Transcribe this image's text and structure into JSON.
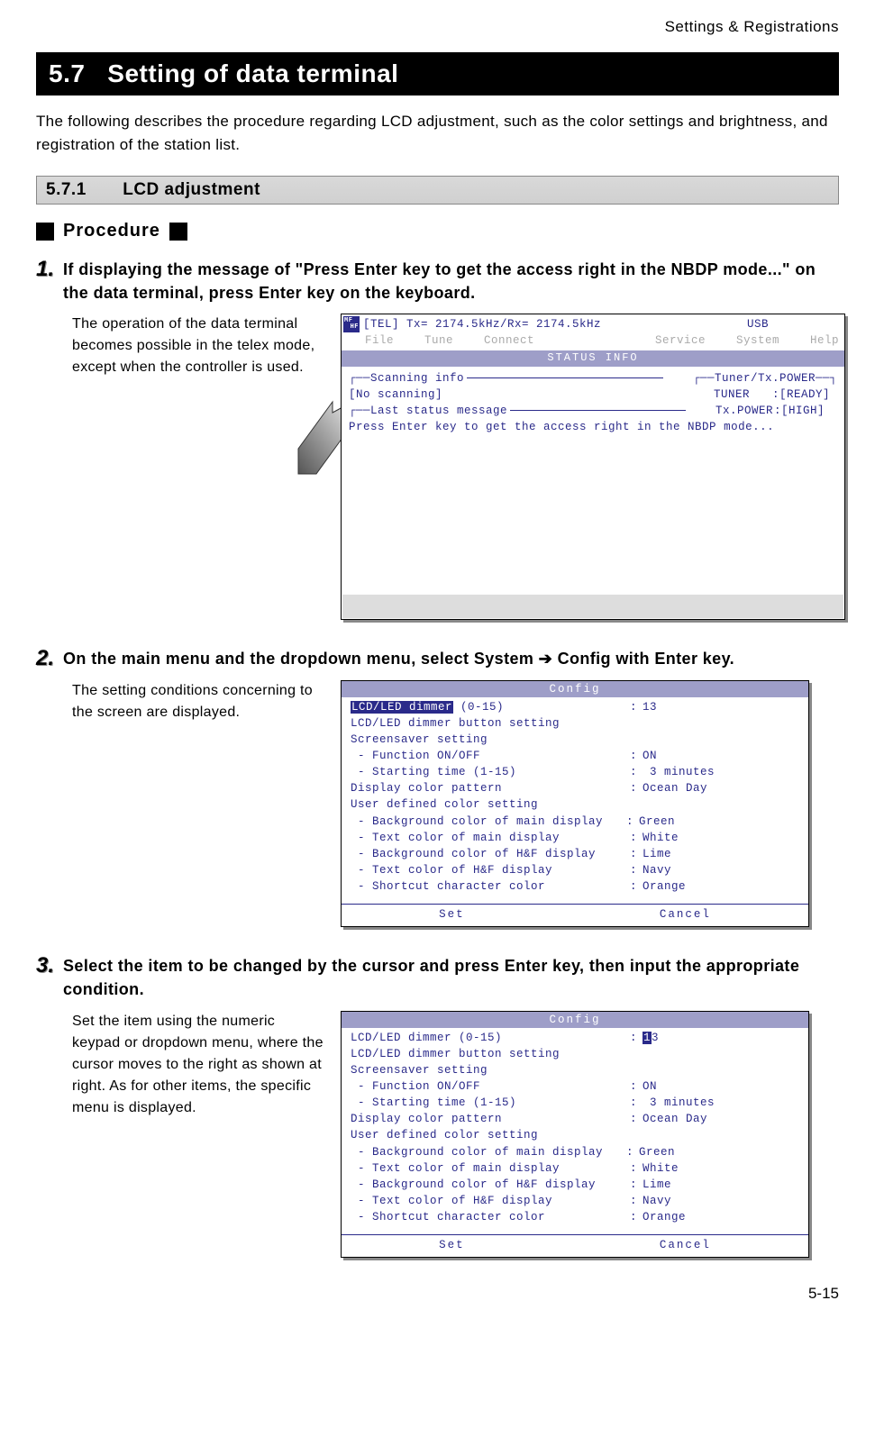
{
  "header": {
    "right": "Settings & Registrations"
  },
  "section": {
    "number": "5.7",
    "title": "Setting of data terminal",
    "intro": "The following describes the procedure regarding LCD adjustment, such as the color settings and brightness, and registration of the station list."
  },
  "subsection": {
    "number": "5.7.1",
    "title": "LCD adjustment"
  },
  "procedure_label": "Procedure",
  "steps": [
    {
      "n": "1",
      "text": "If displaying the message of \"Press Enter key to get the access right in the NBDP mode...\" on the data terminal, press Enter key on the keyboard.",
      "desc": "The operation of the data terminal becomes possible in the telex mode, except when the controller is used."
    },
    {
      "n": "2",
      "text": "On the main menu and the dropdown menu, select System ➔ Config with Enter key.",
      "desc": "The setting conditions concerning to the screen are displayed."
    },
    {
      "n": "3",
      "text": "Select the item to be changed by the cursor and press Enter key, then input the appropriate condition.",
      "desc": "Set the item using the numeric keypad or dropdown menu, where the cursor moves to the right as shown at right. As for other items, the specific menu is displayed."
    }
  ],
  "term1": {
    "badge_top": "MF",
    "badge_bot": "HF",
    "topline": "[TEL] Tx= 2174.5kHz/Rx= 2174.5kHz",
    "usb": "USB",
    "menu": [
      "File",
      "Tune",
      "Connect",
      "Service",
      "System",
      "Help"
    ],
    "status_info": "STATUS INFO",
    "scanning_label": "Scanning info",
    "scanning_value": "[No scanning]",
    "tuner_label": "Tuner/Tx.POWER",
    "tuner_line1_l": "TUNER",
    "tuner_line1_v": ":[READY]",
    "tuner_line2_l": "Tx.POWER",
    "tuner_line2_v": ":[HIGH]",
    "laststatus_label": "Last status message",
    "laststatus_value": "Press Enter key to get the access right in the NBDP mode..."
  },
  "config": {
    "title": "Config",
    "rows": [
      {
        "label": "LCD/LED dimmer (0-15)",
        "val": "13",
        "hl_label_part": "LCD/LED dimmer"
      },
      {
        "label": "LCD/LED dimmer button setting",
        "val": ""
      },
      {
        "label": "Screensaver setting",
        "val": ""
      },
      {
        "label": " - Function ON/OFF",
        "val": "ON"
      },
      {
        "label": " - Starting time (1-15)",
        "val": " 3 minutes"
      },
      {
        "label": "Display color pattern",
        "val": "Ocean Day"
      },
      {
        "label": "User defined color setting",
        "val": ""
      },
      {
        "label": " - Background color of main display",
        "val": "Green",
        "tight": true
      },
      {
        "label": " - Text color of main display",
        "val": "White"
      },
      {
        "label": " - Background color of H&F display",
        "val": "Lime"
      },
      {
        "label": " - Text color of H&F display",
        "val": "Navy"
      },
      {
        "label": " - Shortcut character color",
        "val": "Orange"
      }
    ],
    "set": "Set",
    "cancel": "Cancel",
    "edit_val_first": "1",
    "edit_val_rest": "3"
  },
  "footer": {
    "page": "5-15"
  }
}
